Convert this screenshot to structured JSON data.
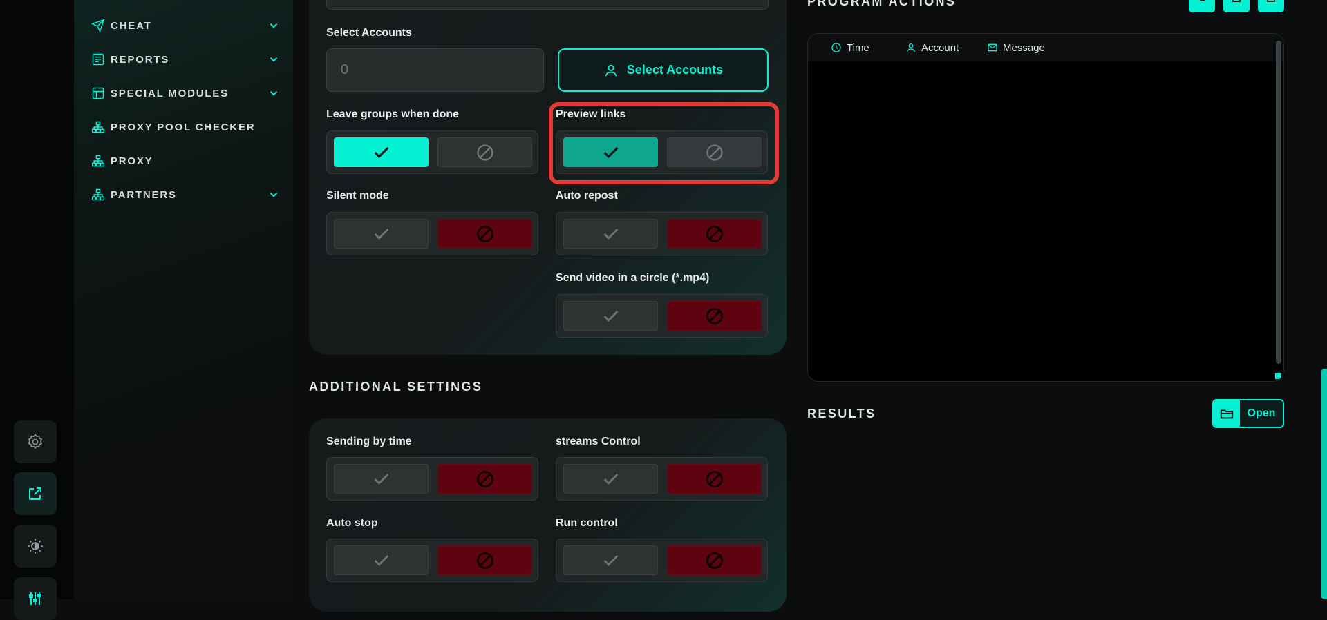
{
  "sidebar": {
    "items": [
      {
        "label": "CHEAT",
        "icon": "send-icon",
        "has_chevron": true
      },
      {
        "label": "REPORTS",
        "icon": "report-icon",
        "has_chevron": true
      },
      {
        "label": "SPECIAL MODULES",
        "icon": "modules-icon",
        "has_chevron": true
      },
      {
        "label": "PROXY POOL CHECKER",
        "icon": "network-icon",
        "has_chevron": false
      },
      {
        "label": "PROXY",
        "icon": "network-icon",
        "has_chevron": false
      },
      {
        "label": "PARTNERS",
        "icon": "network-icon",
        "has_chevron": true
      }
    ]
  },
  "rail": {
    "buttons": [
      "settings-icon",
      "external-link-icon",
      "theme-toggle-icon",
      "sliders-icon"
    ]
  },
  "main": {
    "select_accounts_label": "Select Accounts",
    "accounts_input_value": "0",
    "select_accounts_button": "Select Accounts",
    "settings": [
      {
        "label": "Leave groups when done",
        "state": "on"
      },
      {
        "label": "Preview links",
        "state": "on"
      },
      {
        "label": "Silent mode",
        "state": "off"
      },
      {
        "label": "Auto repost",
        "state": "off"
      },
      {
        "label": "Send video in a circle (*.mp4)",
        "state": "off"
      }
    ],
    "additional_title": "ADDITIONAL SETTINGS",
    "additional": [
      {
        "label": "Sending by time",
        "state": "off"
      },
      {
        "label": "streams Control",
        "state": "off"
      },
      {
        "label": "Auto stop",
        "state": "off"
      },
      {
        "label": "Run control",
        "state": "off"
      }
    ]
  },
  "right": {
    "program_actions_title": "PROGRAM ACTIONS",
    "log_columns": [
      {
        "label": "Time",
        "icon": "clock-icon"
      },
      {
        "label": "Account",
        "icon": "user-icon"
      },
      {
        "label": "Message",
        "icon": "mail-icon"
      }
    ],
    "results_title": "RESULTS",
    "open_button": "Open"
  },
  "colors": {
    "accent": "#05f1d4",
    "accent_muted": "#0fa68e",
    "off_red": "#5e0410",
    "highlight": "#e53935"
  }
}
